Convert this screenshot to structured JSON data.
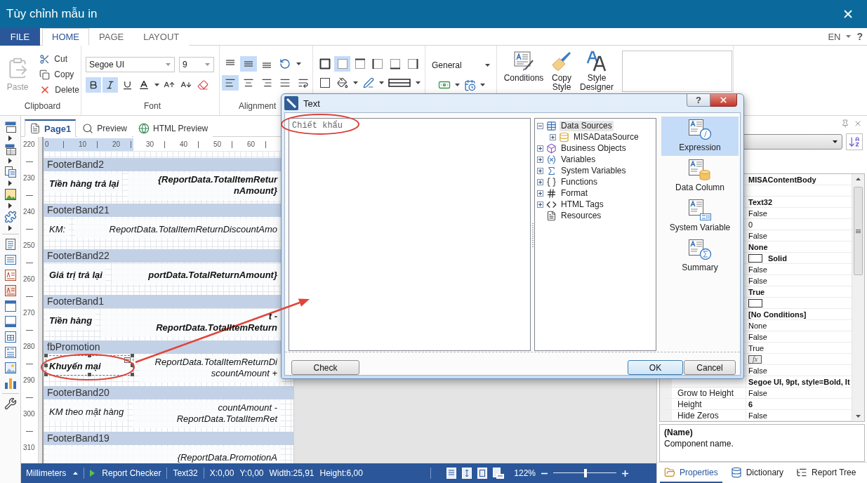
{
  "window": {
    "title": "Tùy chỉnh mẫu in"
  },
  "ribbon": {
    "tabs": [
      {
        "label": "FILE",
        "kind": "file",
        "selected": false
      },
      {
        "label": "HOME",
        "kind": "tab",
        "selected": true
      },
      {
        "label": "PAGE",
        "kind": "tab",
        "selected": false
      },
      {
        "label": "LAYOUT",
        "kind": "tab",
        "selected": false
      }
    ],
    "language": "EN",
    "help": "?",
    "clipboard": {
      "label": "Clipboard",
      "paste": {
        "label": "Paste",
        "disabled": true
      },
      "actions": [
        {
          "label": "Cut",
          "kind": "cut"
        },
        {
          "label": "Copy",
          "kind": "copy"
        },
        {
          "label": "Delete",
          "kind": "delete"
        }
      ]
    },
    "font": {
      "label": "Font",
      "name": "Segoe UI",
      "size": "9",
      "bold": true,
      "italic": true,
      "underline": false
    },
    "alignment": {
      "label": "Alignment",
      "vertical": [
        {
          "kind": "top",
          "selected": false
        },
        {
          "kind": "middle",
          "selected": true
        },
        {
          "kind": "bottom",
          "selected": false
        }
      ],
      "horizontal": [
        {
          "kind": "left",
          "selected": true
        },
        {
          "kind": "center",
          "selected": false
        },
        {
          "kind": "right",
          "selected": false
        },
        {
          "kind": "justify",
          "selected": false
        }
      ]
    },
    "borders": [
      {
        "kind": "all",
        "selected": false
      },
      {
        "kind": "none",
        "selected": true
      },
      {
        "kind": "top",
        "selected": false
      },
      {
        "kind": "left",
        "selected": false
      },
      {
        "kind": "bottom",
        "selected": false
      },
      {
        "kind": "right",
        "selected": false
      }
    ],
    "format": {
      "value": "General"
    },
    "styles": [
      {
        "label": "Conditions",
        "kind": "conditions"
      },
      {
        "label": "Copy Style",
        "kind": "copy_style"
      },
      {
        "label": "Style Designer",
        "kind": "style_designer"
      }
    ]
  },
  "designer": {
    "tabs": [
      {
        "label": "Page1",
        "kind": "page",
        "selected": true
      },
      {
        "label": "Preview",
        "kind": "preview",
        "selected": false
      },
      {
        "label": "HTML Preview",
        "kind": "html_preview",
        "selected": false
      }
    ],
    "horizontal_ruler": {
      "labels": [
        "0",
        "10",
        "20",
        "30",
        "40",
        "50",
        "60"
      ],
      "level": 0.36
    },
    "vertical_ruler": {
      "labels": [
        "220",
        "230",
        "240",
        "250",
        "260",
        "270",
        "280",
        "290",
        "300",
        "310"
      ]
    },
    "bands": [
      {
        "name": "FooterBand2",
        "cells": [
          {
            "kind": "label",
            "lines": [
              "Tiền hàng trả lại"
            ],
            "bold": true,
            "selected": false
          },
          {
            "kind": "expression",
            "lines": [
              "{ReportData.TotalItemRetur",
              "nAmount}"
            ],
            "bold": true,
            "selected": false
          }
        ]
      },
      {
        "name": "FooterBand21",
        "cells": [
          {
            "kind": "label",
            "lines": [
              "KM:"
            ],
            "bold": false,
            "selected": false
          },
          {
            "kind": "expression",
            "lines": [
              "ReportData.TotalItemReturnDiscountAmo"
            ],
            "bold": false,
            "selected": false
          }
        ]
      },
      {
        "name": "FooterBand22",
        "cells": [
          {
            "kind": "label",
            "lines": [
              "Giá trị trả lại"
            ],
            "bold": true,
            "selected": false
          },
          {
            "kind": "expression",
            "lines": [
              "portData.TotalReturnAmount}"
            ],
            "bold": true,
            "selected": false
          }
        ]
      },
      {
        "name": "FooterBand1",
        "cells": [
          {
            "kind": "label",
            "lines": [
              "Tiền hàng"
            ],
            "bold": true,
            "selected": false
          },
          {
            "kind": "expression",
            "lines": [
              "t -",
              "ReportData.TotalItemReturn"
            ],
            "bold": true,
            "selected": false
          }
        ]
      },
      {
        "name": "fbPromotion",
        "cells": [
          {
            "kind": "label",
            "lines": [
              "Khuyến mại"
            ],
            "bold": true,
            "selected": true
          },
          {
            "kind": "expression",
            "lines": [
              "ReportData.TotalItemReturnDi",
              "scountAmount +"
            ],
            "bold": false,
            "selected": false
          }
        ]
      },
      {
        "name": "FooterBand20",
        "cells": [
          {
            "kind": "label",
            "lines": [
              "KM theo mặt hàng"
            ],
            "bold": false,
            "selected": false
          },
          {
            "kind": "expression",
            "lines": [
              "countAmount -",
              "ReportData.TotalItemRet"
            ],
            "bold": false,
            "selected": false
          }
        ]
      },
      {
        "name": "FooterBand19",
        "cells": [
          {
            "kind": "expression",
            "lines": [
              "{ReportData.PromotionA"
            ],
            "bold": false,
            "selected": false
          }
        ]
      }
    ]
  },
  "dialog": {
    "title": "Text",
    "help": "?",
    "expression": "Chiết khẩu",
    "tree": [
      {
        "label": "Data Sources",
        "kind": "data_sources",
        "expandable": true,
        "expanded": true,
        "selected": true,
        "children": [
          {
            "label": "MISADataSource",
            "kind": "datasource",
            "expandable": true,
            "expanded": false,
            "selected": false
          }
        ]
      },
      {
        "label": "Business Objects",
        "kind": "business_objects",
        "expandable": true,
        "expanded": false,
        "selected": false
      },
      {
        "label": "Variables",
        "kind": "variables",
        "expandable": true,
        "expanded": false,
        "selected": false
      },
      {
        "label": "System Variables",
        "kind": "system_variables",
        "expandable": true,
        "expanded": false,
        "selected": false
      },
      {
        "label": "Functions",
        "kind": "functions",
        "expandable": true,
        "expanded": false,
        "selected": false
      },
      {
        "label": "Format",
        "kind": "format",
        "expandable": true,
        "expanded": false,
        "selected": false
      },
      {
        "label": "HTML Tags",
        "kind": "html_tags",
        "expandable": true,
        "expanded": false,
        "selected": false
      },
      {
        "label": "Resources",
        "kind": "resources",
        "expandable": false,
        "expanded": false,
        "selected": false
      }
    ],
    "modes": [
      {
        "label": "Expression",
        "kind": "expression",
        "selected": true
      },
      {
        "label": "Data Column",
        "kind": "data_column",
        "selected": false
      },
      {
        "label": "System Variable",
        "kind": "system_variable",
        "selected": false
      },
      {
        "label": "Summary",
        "kind": "summary",
        "selected": false
      }
    ],
    "buttons": [
      {
        "label": "Check",
        "kind": "check"
      },
      {
        "label": "OK",
        "kind": "ok"
      },
      {
        "label": "Cancel",
        "kind": "cancel"
      }
    ]
  },
  "properties": {
    "rows": [
      {
        "kind": "text",
        "value": "MISAContentBody",
        "bold": true
      },
      {
        "kind": "blank"
      },
      {
        "kind": "text",
        "value": "Text32",
        "bold": true
      },
      {
        "kind": "text",
        "value": "False",
        "bold": false
      },
      {
        "kind": "text",
        "value": "0",
        "bold": false
      },
      {
        "kind": "text",
        "value": "False",
        "bold": false
      },
      {
        "kind": "text",
        "value": "None",
        "bold": true
      },
      {
        "kind": "swatch_text",
        "value": "Solid",
        "bold": true
      },
      {
        "kind": "text",
        "value": "False",
        "bold": false
      },
      {
        "kind": "text",
        "value": "False",
        "bold": false
      },
      {
        "kind": "text",
        "value": "True",
        "bold": true
      },
      {
        "kind": "swatch"
      },
      {
        "kind": "text",
        "value": "[No Conditions]",
        "bold": true
      },
      {
        "kind": "text",
        "value": "None",
        "bold": false
      },
      {
        "kind": "text",
        "value": "False",
        "bold": false
      },
      {
        "kind": "text",
        "value": "True",
        "bold": false
      },
      {
        "kind": "fx",
        "value": "fx"
      },
      {
        "kind": "text",
        "value": "False",
        "bold": false
      },
      {
        "kind": "text",
        "value": "Segoe UI, 9pt, style=Bold, It",
        "bold": true
      },
      {
        "kind": "text",
        "label": "Grow to Height",
        "value": "False",
        "bold": false
      },
      {
        "kind": "text",
        "label": "Height",
        "value": "6",
        "bold": true
      },
      {
        "kind": "text",
        "label": "Hide Zeros",
        "value": "False",
        "bold": false
      }
    ],
    "description": {
      "title": "(Name)",
      "text": "Component name."
    },
    "tabs": [
      {
        "label": "Properties",
        "kind": "properties",
        "selected": true
      },
      {
        "label": "Dictionary",
        "kind": "dictionary",
        "selected": false
      },
      {
        "label": "Report Tree",
        "kind": "report_tree",
        "selected": false
      }
    ]
  },
  "status_bar": {
    "unit": "Millimeters",
    "checker": "Report Checker",
    "component": "Text32",
    "x": "X:0,00",
    "y": "Y:0,00",
    "width": "Width:25,91",
    "height": "Height:6,00",
    "zoom": "122%",
    "zoom_slider": {
      "level": 0.51
    }
  }
}
